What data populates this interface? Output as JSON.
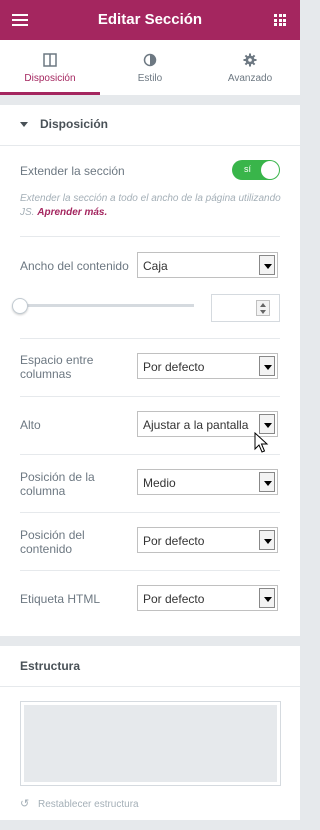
{
  "header": {
    "title": "Editar Sección",
    "menu_icon": "hamburger-icon",
    "apps_icon": "grid-icon",
    "bg_color": "#a4265f"
  },
  "tabs": [
    {
      "label": "Disposición",
      "icon": "columns-icon",
      "active": true
    },
    {
      "label": "Estilo",
      "icon": "contrast-icon",
      "active": false
    },
    {
      "label": "Avanzado",
      "icon": "gear-icon",
      "active": false
    }
  ],
  "layout_section": {
    "title": "Disposición",
    "stretch": {
      "label": "Extender la sección",
      "toggle_text": "sí",
      "enabled": true,
      "description": "Extender la sección a todo el ancho de la página utilizando JS.",
      "link_text": "Aprender más."
    },
    "content_width": {
      "label": "Ancho del contenido",
      "value": "Caja"
    },
    "column_gap": {
      "label": "Espacio entre columnas",
      "value": "Por defecto"
    },
    "height": {
      "label": "Alto",
      "value": "Ajustar a la pantalla"
    },
    "column_position": {
      "label": "Posición de la columna",
      "value": "Medio"
    },
    "content_position": {
      "label": "Posición del contenido",
      "value": "Por defecto"
    },
    "html_tag": {
      "label": "Etiqueta HTML",
      "value": "Por defecto"
    }
  },
  "structure_section": {
    "title": "Estructura",
    "reset_label": "Restablecer estructura"
  }
}
